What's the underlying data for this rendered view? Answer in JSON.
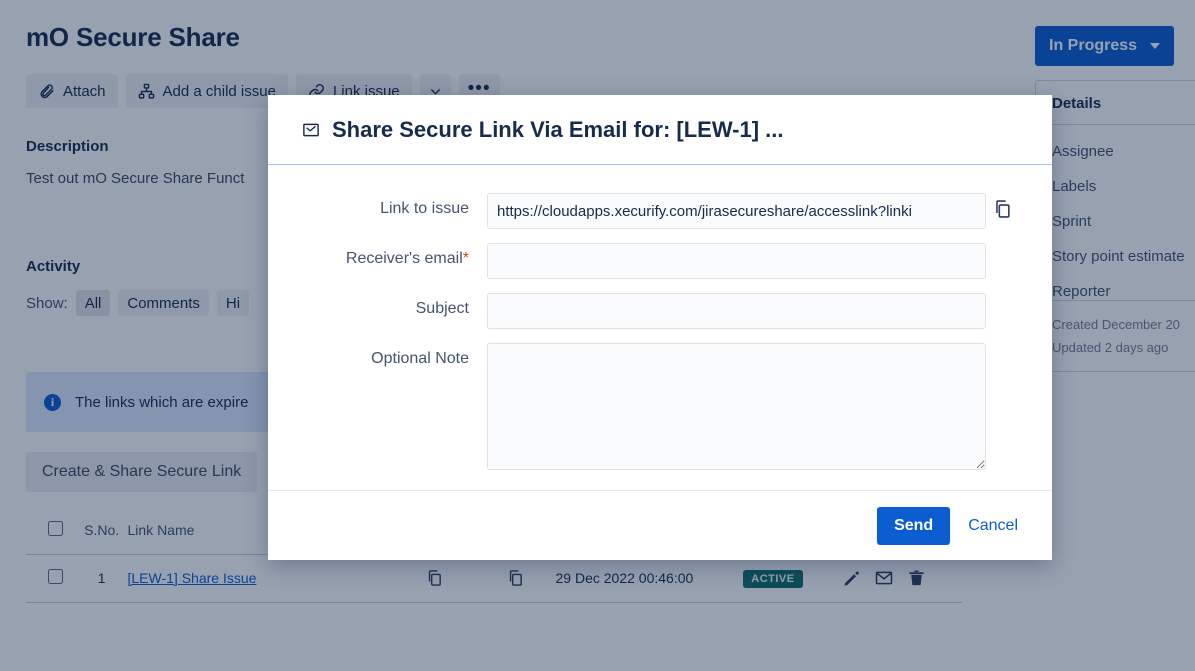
{
  "issue": {
    "title": "mO Secure Share",
    "status": "In Progress",
    "description_heading": "Description",
    "description_text": "Test out mO Secure Share Funct",
    "activity_heading": "Activity",
    "show_label": "Show:"
  },
  "toolbar": {
    "attach": "Attach",
    "add_child": "Add a child issue",
    "link_issue": "Link issue",
    "more": "•••"
  },
  "activity_filters": [
    "All",
    "Comments",
    "Hi"
  ],
  "banner": {
    "text": "The links which are expire",
    "icon": "info-icon"
  },
  "create_button": "Create & Share Secure Link",
  "links_table": {
    "columns": [
      "",
      "S.No.",
      "Link Name",
      "",
      "",
      "",
      "",
      ""
    ],
    "headers": {
      "sno": "S.No.",
      "name": "Link Name"
    },
    "rows": [
      {
        "sno": "1",
        "name": "[LEW-1] Share Issue",
        "date": "29 Dec 2022 00:46:00",
        "status": "ACTIVE"
      }
    ]
  },
  "details": {
    "title": "Details",
    "fields": [
      "Assignee",
      "Labels",
      "Sprint",
      "Story point estimate",
      "Reporter"
    ],
    "created": "Created December 20",
    "updated": "Updated 2 days ago"
  },
  "modal": {
    "title": "Share Secure Link Via Email for: [LEW-1] ...",
    "title_icon": "envelope-icon",
    "fields": {
      "link_label": "Link to issue",
      "link_value": "https://cloudapps.xecurify.com/jirasecureshare/accesslink?linki",
      "link_placeholder": "",
      "email_label": "Receiver's email",
      "email_required_mark": "*",
      "email_value": "",
      "email_placeholder": "",
      "subject_label": "Subject",
      "subject_value": "",
      "subject_placeholder": "",
      "note_label": "Optional Note",
      "note_value": "",
      "note_placeholder": ""
    },
    "send_label": "Send",
    "cancel_label": "Cancel"
  },
  "colors": {
    "brand_blue": "#0c5ed0",
    "text_dark": "#172b4d",
    "active_badge": "#10716b",
    "banner_bg": "#deebff"
  }
}
